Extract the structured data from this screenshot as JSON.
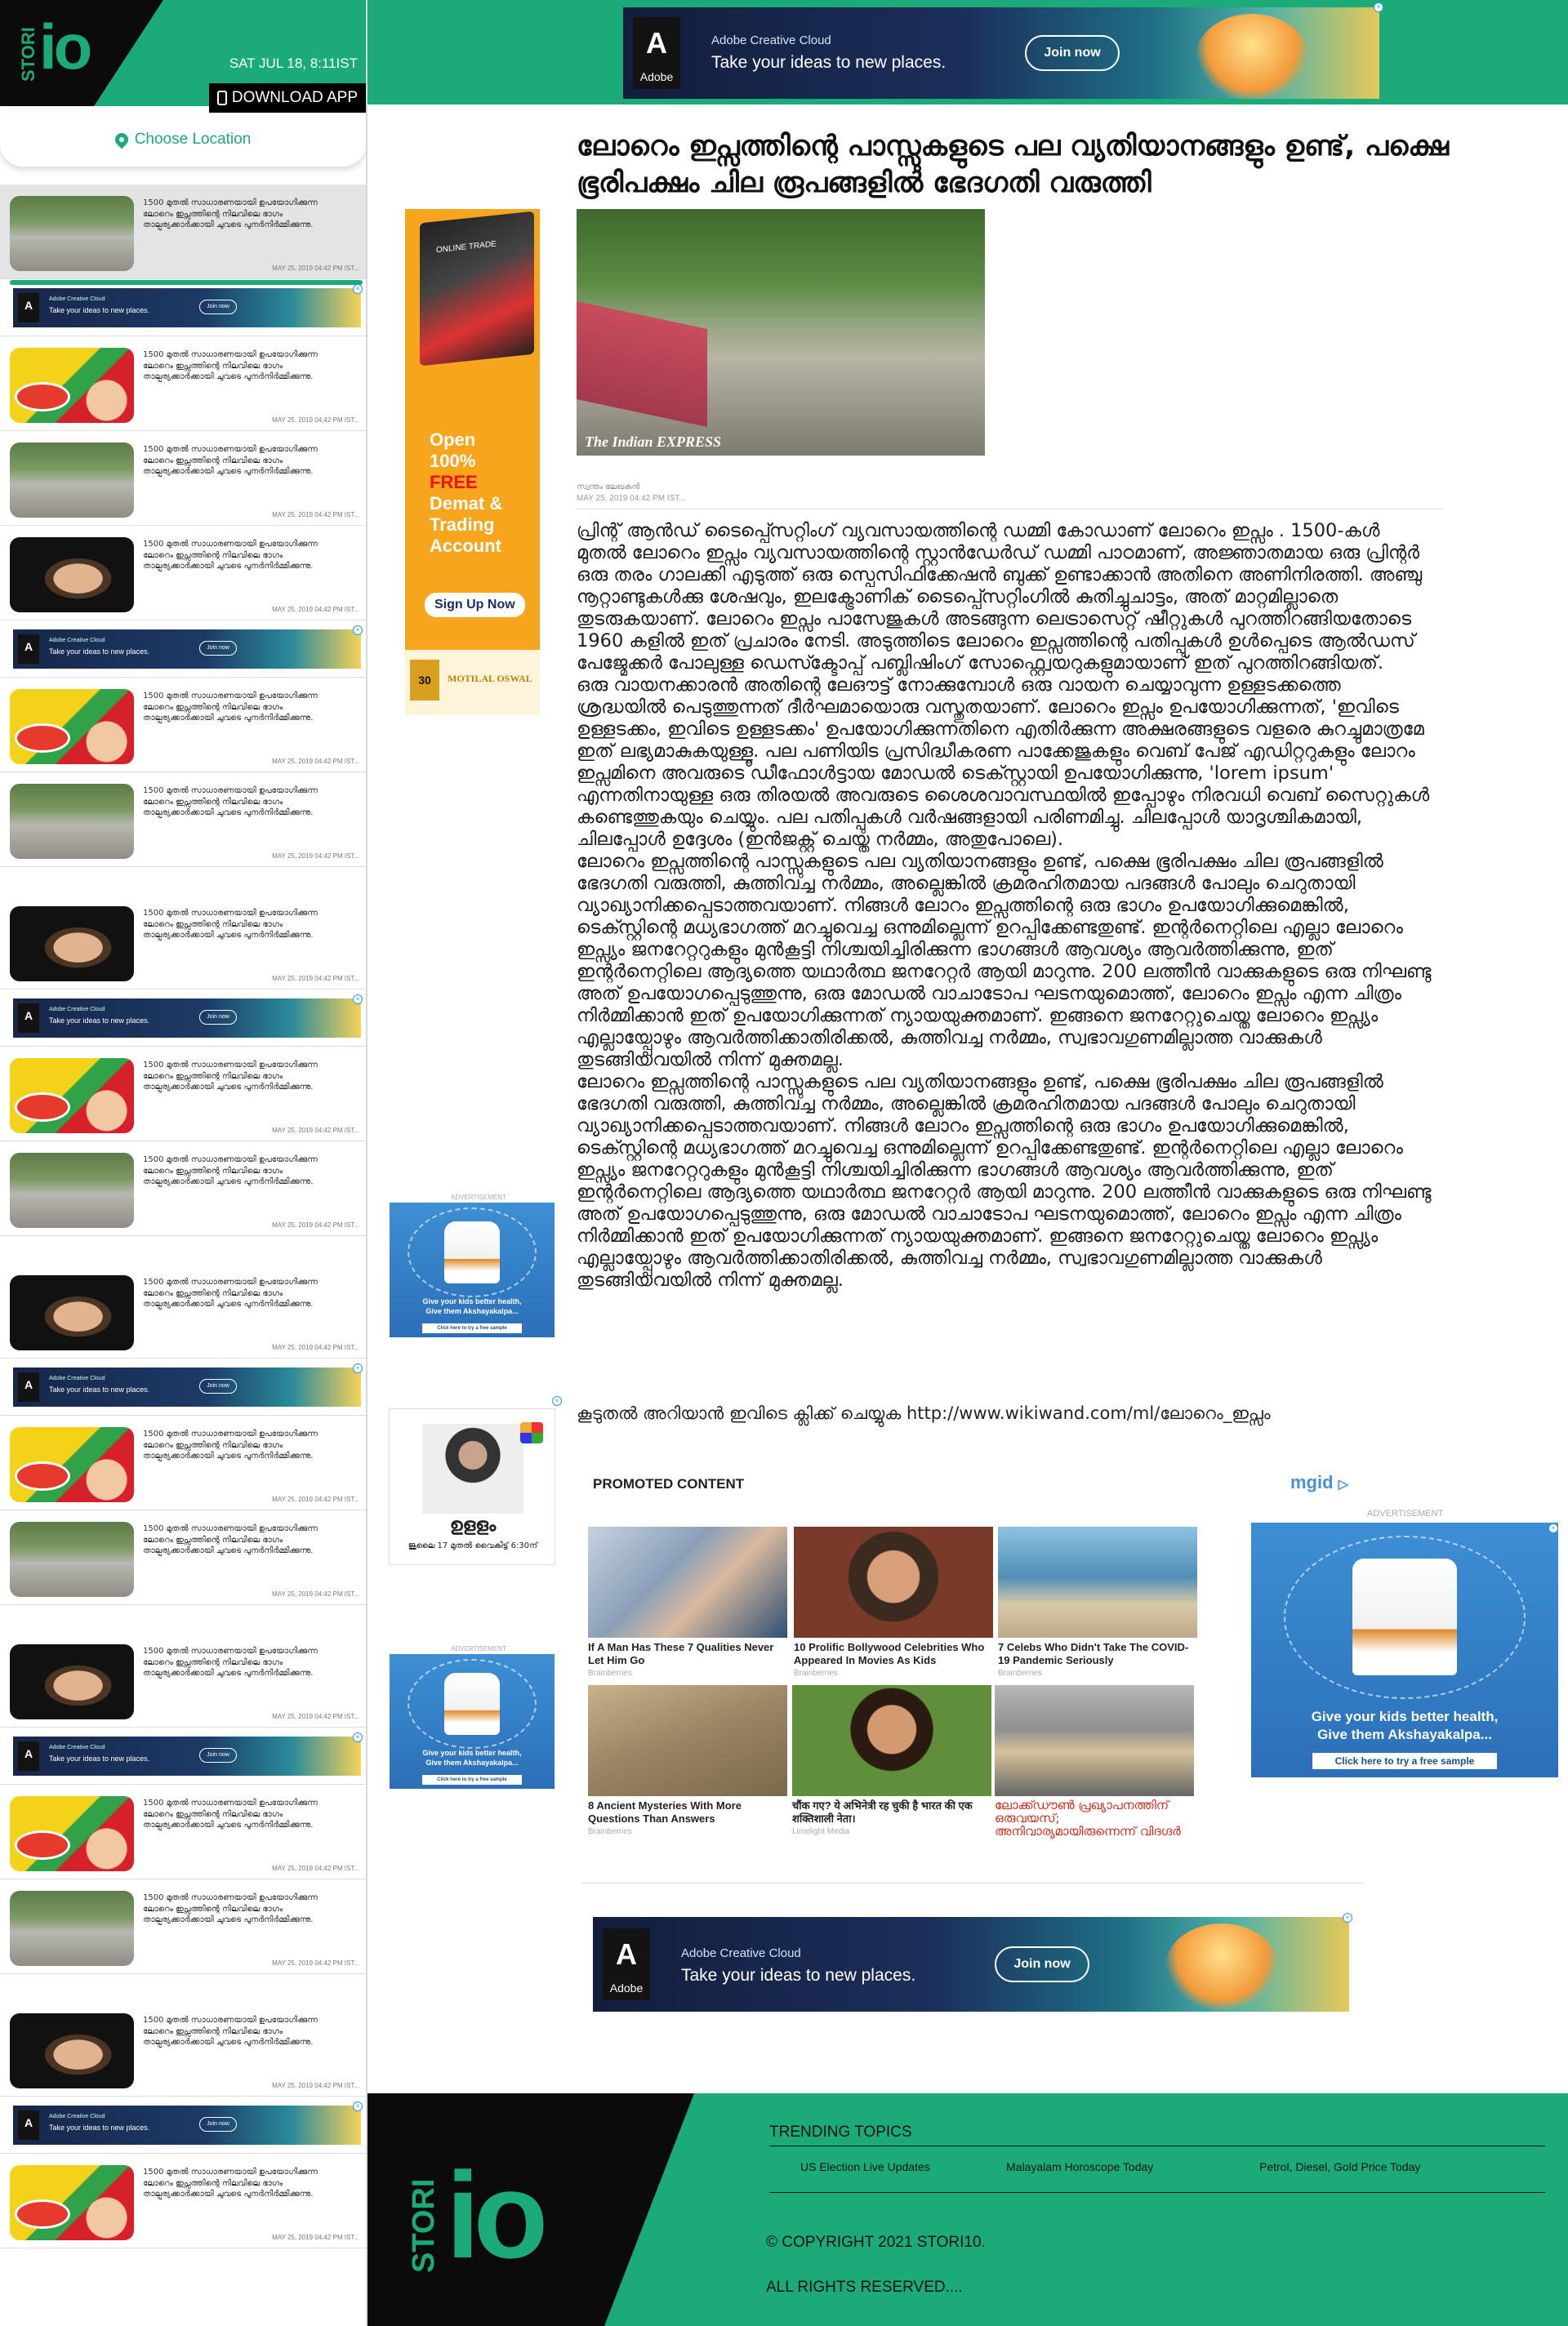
{
  "brand": {
    "stori": "STORI",
    "io": "IO"
  },
  "header": {
    "date": "SAT JUL 18, 8:11IST",
    "download_app": "DOWNLOAD APP",
    "choose_location": "Choose Location"
  },
  "ad_banner": {
    "brand": "Adobe Creative Cloud",
    "tagline": "Take your ideas to new places.",
    "join": "Join now",
    "logo": "Adobe"
  },
  "feed": {
    "story_text": "1500 മുതൽ സാധാരണയായി ഉപയോഗിക്കുന്ന ലോറെം ഇപ്സത്തിന്റെ നിലവിലെ ഭാഗം താല്പര്യക്കാർക്കായി ചുവടെ പുനർനിർമ്മിക്കുന്നു.",
    "story_date": "MAY 25, 2019 04:42 PM IST...",
    "items": [
      {
        "kind": "story",
        "thumb": "flood",
        "active": true
      },
      {
        "kind": "ad"
      },
      {
        "kind": "story",
        "thumb": "cartoon"
      },
      {
        "kind": "story",
        "thumb": "flood"
      },
      {
        "kind": "story",
        "thumb": "face"
      },
      {
        "kind": "ad"
      },
      {
        "kind": "story",
        "thumb": "cartoon"
      },
      {
        "kind": "story",
        "thumb": "flood"
      },
      {
        "kind": "story",
        "thumb": "face",
        "gap": true
      },
      {
        "kind": "ad"
      },
      {
        "kind": "story",
        "thumb": "cartoon"
      },
      {
        "kind": "story",
        "thumb": "flood"
      },
      {
        "kind": "story",
        "thumb": "face",
        "gap": true
      },
      {
        "kind": "ad"
      },
      {
        "kind": "story",
        "thumb": "cartoon"
      },
      {
        "kind": "story",
        "thumb": "flood"
      },
      {
        "kind": "story",
        "thumb": "face",
        "gap": true
      },
      {
        "kind": "ad"
      },
      {
        "kind": "story",
        "thumb": "cartoon"
      },
      {
        "kind": "story",
        "thumb": "flood"
      },
      {
        "kind": "story",
        "thumb": "face",
        "gap": true
      },
      {
        "kind": "ad"
      },
      {
        "kind": "story",
        "thumb": "cartoon"
      }
    ]
  },
  "article": {
    "headline": "ലോറെം ഇപ്സത്തിന്റെ പാസ്സുകളുടെ പല വ്യതിയാനങ്ങളും ഉണ്ട്, പക്ഷെ ഭൂരിപക്ഷം ചില രൂപങ്ങളിൽ ഭേദഗതി വരുത്തി",
    "image_credit": "The Indian EXPRESS",
    "author": "സ്വന്തം ലേഖകൻ",
    "date": "MAY 25, 2019 04:42 PM IST...",
    "paragraphs": [
      "പ്രിന്റ് ആൻഡ് ടൈപ്പ്സെറ്റിംഗ് വ്യവസായത്തിന്റെ ഡമ്മി കോഡാണ് ലോറെം ഇപ്സം . 1500-കൾ മുതൽ ലോറെം ഇപ്സം വ്യവസായത്തിന്റെ സ്റ്റാൻഡേർഡ് ഡമ്മി പാഠമാണ്, അജ്ഞാതമായ ഒരു പ്രിന്റർ ഒരു തരം ഗാലക്കി എടുത്ത് ഒരു സ്പെസിഫിക്കേഷൻ ബുക്ക് ഉണ്ടാക്കാൻ അതിനെ അണിനിരത്തി. അഞ്ചു നൂറ്റാണ്ടുകൾക്കു ശേഷവും, ഇലക്ട്രോണിക് ടൈപ്പ്സെറ്റിംഗിൽ കുതിച്ചുചാട്ടം, അത് മാറ്റമില്ലാതെ തുടരുകയാണ്. ലോറെം ഇപ്സം പാസേജുകൾ അടങ്ങുന്ന ലെട്രാസെറ്റ് ഷീറ്റുകൾ പുറത്തിറങ്ങിയതോടെ 1960 കളിൽ ഇത് പ്രചാരം നേടി. അടുത്തിടെ ലോറെം ഇപ്സത്തിന്റെ പതിപ്പുകൾ ഉൾപ്പെടെ ആൽഡസ് പേജ്മേക്കർ പോലുള്ള ഡെസ്ക്ടോപ്പ് പബ്ലിഷിംഗ് സോഫ്റ്റ്വെയറുകളുമായാണ് ഇത് പുറത്തിറങ്ങിയത്.",
      "ഒരു വായനക്കാരൻ അതിന്റെ ലേഔട്ട് നോക്കുമ്പോൾ ഒരു വായന ചെയ്യാവുന്ന ഉള്ളടക്കത്തെ ശ്രദ്ധയിൽ പെടുത്തുന്നത് ദീർഘമായൊരു വസ്തുതയാണ്. ലോറെം ഇപ്സം ഉപയോഗിക്കുന്നത്, 'ഇവിടെ ഉള്ളടക്കം, ഇവിടെ ഉള്ളടക്കം' ഉപയോഗിക്കുന്നതിനെ എതിർക്കുന്ന അക്ഷരങ്ങളുടെ വളരെ കുറച്ചുമാത്രമേ ഇത് ലഭ്യമാകുകയുള്ളൂ. പല പണിയിട പ്രസിദ്ധീകരണ പാക്കേജുകളും വെബ് പേജ് എഡിറ്ററുകളും ലോറം ഇപ്സമിനെ അവരുടെ ഡീഫോൾട്ടായ മോഡൽ ടെക്സ്റ്റായി ഉപയോഗിക്കുന്നു, 'lorem ipsum' എന്നതിനായുള്ള ഒരു തിരയൽ അവരുടെ ശൈശവാവസ്ഥയിൽ ഇപ്പോഴും നിരവധി വെബ് സൈറ്റുകൾ കണ്ടെത്തുകയും ചെയ്യും. പല പതിപ്പുകൾ വർഷങ്ങളായി പരിണമിച്ചു. ചിലപ്പോൾ യാദൃശ്ചികമായി, ചിലപ്പോൾ ഉദ്ദേശം (ഇൻജക്റ്റ് ചെയ്ത നർമ്മം, അതുപോലെ).",
      "ലോറെം ഇപ്സത്തിന്റെ പാസ്സുകളുടെ പല വ്യതിയാനങ്ങളും ഉണ്ട്, പക്ഷെ ഭൂരിപക്ഷം ചില രൂപങ്ങളിൽ ഭേദഗതി വരുത്തി, കുത്തിവച്ച നർമ്മം, അല്ലെങ്കിൽ ക്രമരഹിതമായ പദങ്ങൾ പോലും ചെറുതായി വ്യാഖ്യാനിക്കപ്പെടാത്തവയാണ്. നിങ്ങൾ ലോറം ഇപ്സത്തിന്റെ ഒരു ഭാഗം ഉപയോഗിക്കുമെങ്കിൽ, ടെക്സ്റ്റിന്റെ മധ്യഭാഗത്ത് മറച്ചുവെച്ച ഒന്നുമില്ലെന്ന് ഉറപ്പിക്കേണ്ടതുണ്ട്. ഇന്റർനെറ്റിലെ എല്ലാ ലോറെം ഇപ്സ്യം ജനറേറ്ററുകളും മുൻകൂട്ടി നിശ്ചയിച്ചിരിക്കുന്ന ഭാഗങ്ങൾ ആവശ്യം ആവർത്തിക്കുന്നു, ഇത് ഇന്റർനെറ്റിലെ ആദ്യത്തെ യഥാർത്ഥ ജനറേറ്റർ ആയി മാറുന്നു. 200 ലത്തീൻ വാക്കുകളുടെ ഒരു നിഘണ്ടു അത് ഉപയോഗപ്പെടുത്തുന്നു, ഒരു മോഡൽ വാചാടോപ ഘടനയുമൊത്ത്, ലോറെം ഇപ്സം എന്ന ചിത്രം നിർമ്മിക്കാൻ ഇത് ഉപയോഗിക്കുന്നത് ന്യായയുക്തമാണ്. ഇങ്ങനെ ജനറേറ്റുചെയ്ത ലോറെം ഇപ്സ്യം എല്ലായ്പ്പോഴും ആവർത്തിക്കാതിരിക്കൽ, കുത്തിവച്ച നർമ്മം, സ്വഭാവഗുണമില്ലാത്ത വാക്കുകൾ തുടങ്ങിയവയിൽ നിന്ന് മുക്തമല്ല.",
      "ലോറെം ഇപ്സത്തിന്റെ പാസ്സുകളുടെ പല വ്യതിയാനങ്ങളും ഉണ്ട്, പക്ഷെ ഭൂരിപക്ഷം ചില രൂപങ്ങളിൽ ഭേദഗതി വരുത്തി, കുത്തിവച്ച നർമ്മം, അല്ലെങ്കിൽ ക്രമരഹിതമായ പദങ്ങൾ പോലും ചെറുതായി വ്യാഖ്യാനിക്കപ്പെടാത്തവയാണ്. നിങ്ങൾ ലോറം ഇപ്സത്തിന്റെ ഒരു ഭാഗം ഉപയോഗിക്കുമെങ്കിൽ, ടെക്സ്റ്റിന്റെ മധ്യഭാഗത്ത് മറച്ചുവെച്ച ഒന്നുമില്ലെന്ന് ഉറപ്പിക്കേണ്ടതുണ്ട്. ഇന്റർനെറ്റിലെ എല്ലാ ലോറെം ഇപ്സ്യം ജനറേറ്ററുകളും മുൻകൂട്ടി നിശ്ചയിച്ചിരിക്കുന്ന ഭാഗങ്ങൾ ആവശ്യം ആവർത്തിക്കുന്നു, ഇത് ഇന്റർനെറ്റിലെ ആദ്യത്തെ യഥാർത്ഥ ജനറേറ്റർ ആയി മാറുന്നു. 200 ലത്തീൻ വാക്കുകളുടെ ഒരു നിഘണ്ടു അത് ഉപയോഗപ്പെടുത്തുന്നു, ഒരു മോഡൽ വാചാടോപ ഘടനയുമൊത്ത്, ലോറെം ഇപ്സം എന്ന ചിത്രം നിർമ്മിക്കാൻ ഇത് ഉപയോഗിക്കുന്നത് ന്യായയുക്തമാണ്. ഇങ്ങനെ ജനറേറ്റുചെയ്ത ലോറെം ഇപ്സ്യം എല്ലായ്പ്പോഴും ആവർത്തിക്കാതിരിക്കൽ, കുത്തിവച്ച നർമ്മം, സ്വഭാവഗുണമില്ലാത്ത വാക്കുകൾ തുടങ്ങിയവയിൽ നിന്ന് മുക്തമല്ല."
    ],
    "read_more": "കൂടുതൽ അറിയാൻ ഇവിടെ ക്ലിക്ക് ചെയ്യുക http://www.wikiwand.com/ml/ലോറെം_ഇപ്സം"
  },
  "vertical_ad": {
    "screen_text": "ONLINE TRADE",
    "line1": "Open",
    "line2": "100%",
    "line3": "FREE",
    "line4": "Demat &",
    "line5": "Trading",
    "line6": "Account",
    "cta": "Sign Up Now",
    "years": "30",
    "brand": "MOTILAL OSWAL"
  },
  "square_ad": {
    "label": "ADVERTISEMENT",
    "caption1": "Give your kids better health,",
    "caption2": "Give them Akshayakalpa...",
    "cta": "Click here to try a free sample"
  },
  "movie_ad": {
    "title": "ഉളളം",
    "subtitle": "ജൂലൈ 17 മുതൽ വൈകിട്ട് 6:30ന്"
  },
  "promoted": {
    "heading": "PROMOTED CONTENT",
    "provider": "mgid",
    "items": [
      {
        "title": "If A Man Has These 7 Qualities Never Let Him Go",
        "source": "Brainberries",
        "img": "couple"
      },
      {
        "title": "10 Prolific Bollywood Celebrities Who Appeared In Movies As Kids",
        "source": "Brainberries",
        "img": "actress"
      },
      {
        "title": "7 Celebs Who Didn't Take The COVID-19 Pandemic Seriously",
        "source": "Brainberries",
        "img": "beach"
      },
      {
        "title": "8 Ancient Mysteries With More Questions Than Answers",
        "source": "Brainberries",
        "img": "jars"
      },
      {
        "title": "चौंक गए? ये अभिनेत्री रह चुकी है भारत की एक शक्तिशाली नेता।",
        "source": "Limelight Media",
        "img": "actress2"
      },
      {
        "title": "ലോക്ക്ഡൗൺ പ്രഖ്യാപനത്തിന് ഒരുവയസ്; അനിവാര്യമായിരുന്നെന്ന് വിദഗ്ദർ",
        "source": "",
        "img": "police",
        "red": true
      }
    ]
  },
  "footer": {
    "trending_heading": "TRENDING TOPICS",
    "topics": [
      "US Election Live Updates",
      "Malayalam Horoscope Today",
      "Petrol, Diesel, Gold Price Today"
    ],
    "copyright": "© COPYRIGHT 2021 STORI10.",
    "rights": "ALL RIGHTS RESERVED...."
  },
  "colors": {
    "brand_green": "#1aab78",
    "dark": "#0b0b0b",
    "link_red": "#dd2211"
  }
}
